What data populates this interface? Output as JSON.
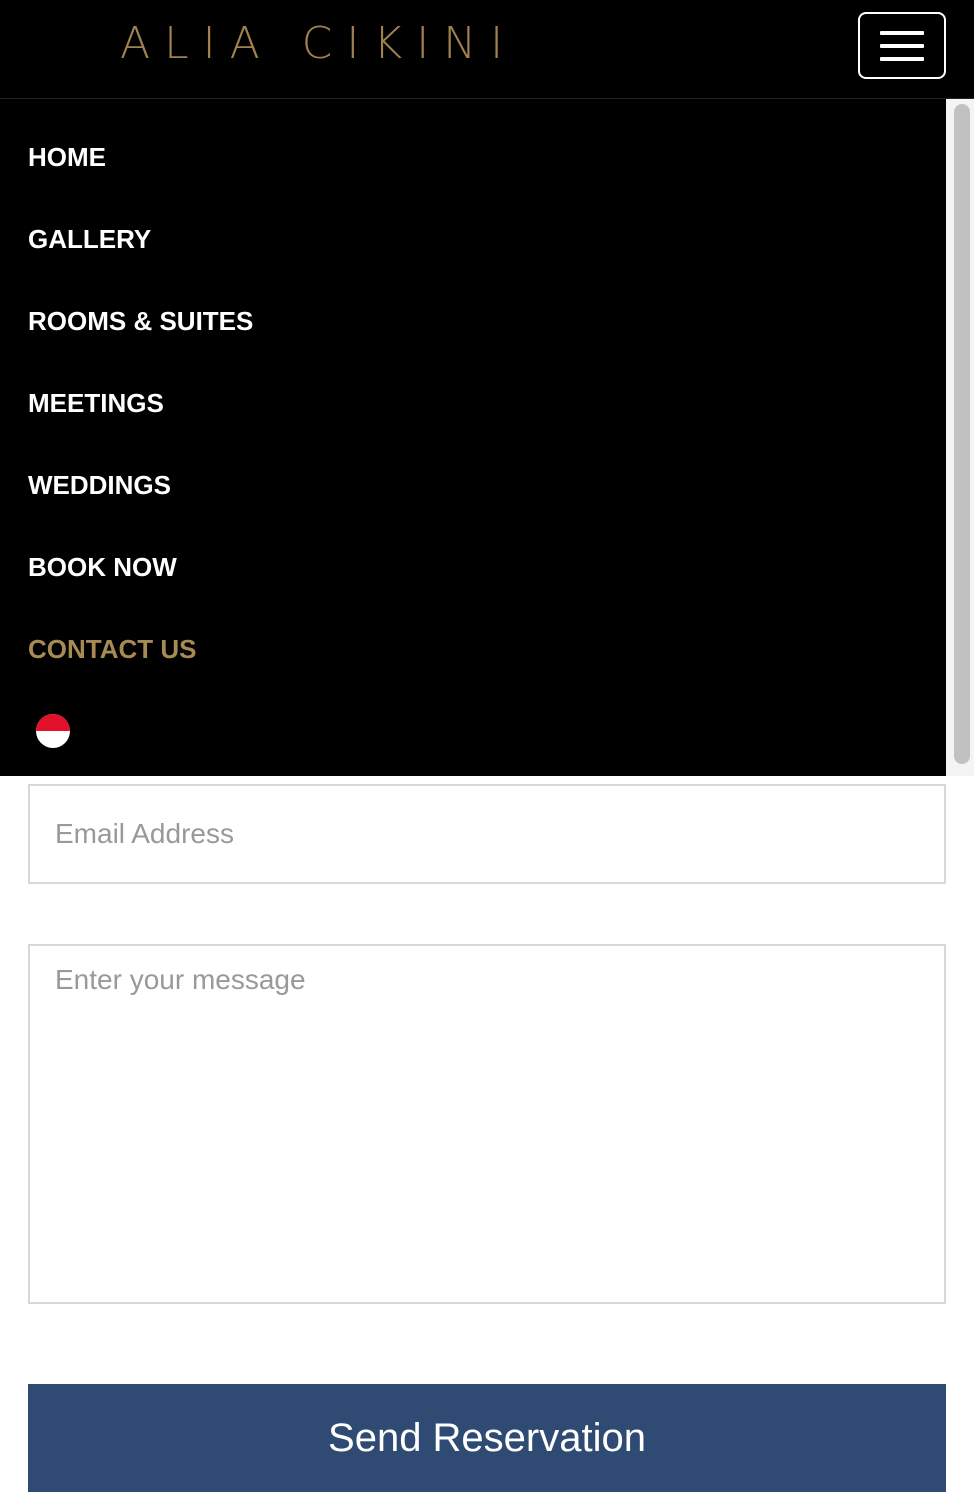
{
  "header": {
    "logo_text": "ALIA CIKINI",
    "menu_icon": "hamburger-icon"
  },
  "nav": {
    "items": [
      {
        "label": "HOME"
      },
      {
        "label": "GALLERY"
      },
      {
        "label": "ROOMS & SUITES"
      },
      {
        "label": "MEETINGS"
      },
      {
        "label": "WEDDINGS"
      },
      {
        "label": "BOOK NOW"
      },
      {
        "label": "CONTACT US",
        "active": true
      }
    ],
    "language_icon": "indonesia-flag-icon"
  },
  "form": {
    "email": {
      "value": "",
      "placeholder": "Email Address"
    },
    "message": {
      "value": "",
      "placeholder": "Enter your message"
    },
    "submit_label": "Send Reservation"
  },
  "colors": {
    "brand_gold": "#a0824f",
    "nav_text": "#ffffff",
    "nav_active": "#a88a55",
    "header_bg": "#000000",
    "button_bg": "#2f4b74",
    "flag_red": "#e3102c"
  }
}
